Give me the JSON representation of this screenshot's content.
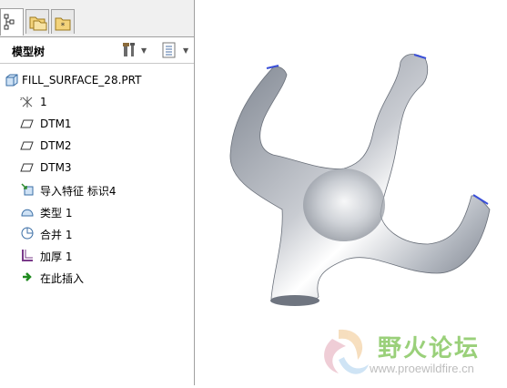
{
  "panel": {
    "title": "模型树"
  },
  "tabs": [
    {
      "icon": "model-tree-tab-icon",
      "active": true
    },
    {
      "icon": "folder-browser-tab-icon",
      "active": false
    },
    {
      "icon": "favorites-tab-icon",
      "active": false
    }
  ],
  "tree": {
    "root": {
      "label": "FILL_SURFACE_28.PRT",
      "icon": "part-icon"
    },
    "items": [
      {
        "label": "1",
        "icon": "coordinate-system-icon"
      },
      {
        "label": "DTM1",
        "icon": "datum-plane-icon"
      },
      {
        "label": "DTM2",
        "icon": "datum-plane-icon"
      },
      {
        "label": "DTM3",
        "icon": "datum-plane-icon"
      },
      {
        "label": "导入特征 标识4",
        "icon": "import-feature-icon"
      },
      {
        "label": "类型 1",
        "icon": "surface-type-icon"
      },
      {
        "label": "合并 1",
        "icon": "merge-icon"
      },
      {
        "label": "加厚 1",
        "icon": "thicken-icon"
      },
      {
        "label": "在此插入",
        "icon": "insert-here-arrow-icon"
      }
    ]
  },
  "watermark": {
    "text": "野火论坛",
    "url": "www.proewildfire.cn"
  },
  "colors": {
    "model": "#a9aeb6",
    "watermark": "#9ad07a"
  }
}
